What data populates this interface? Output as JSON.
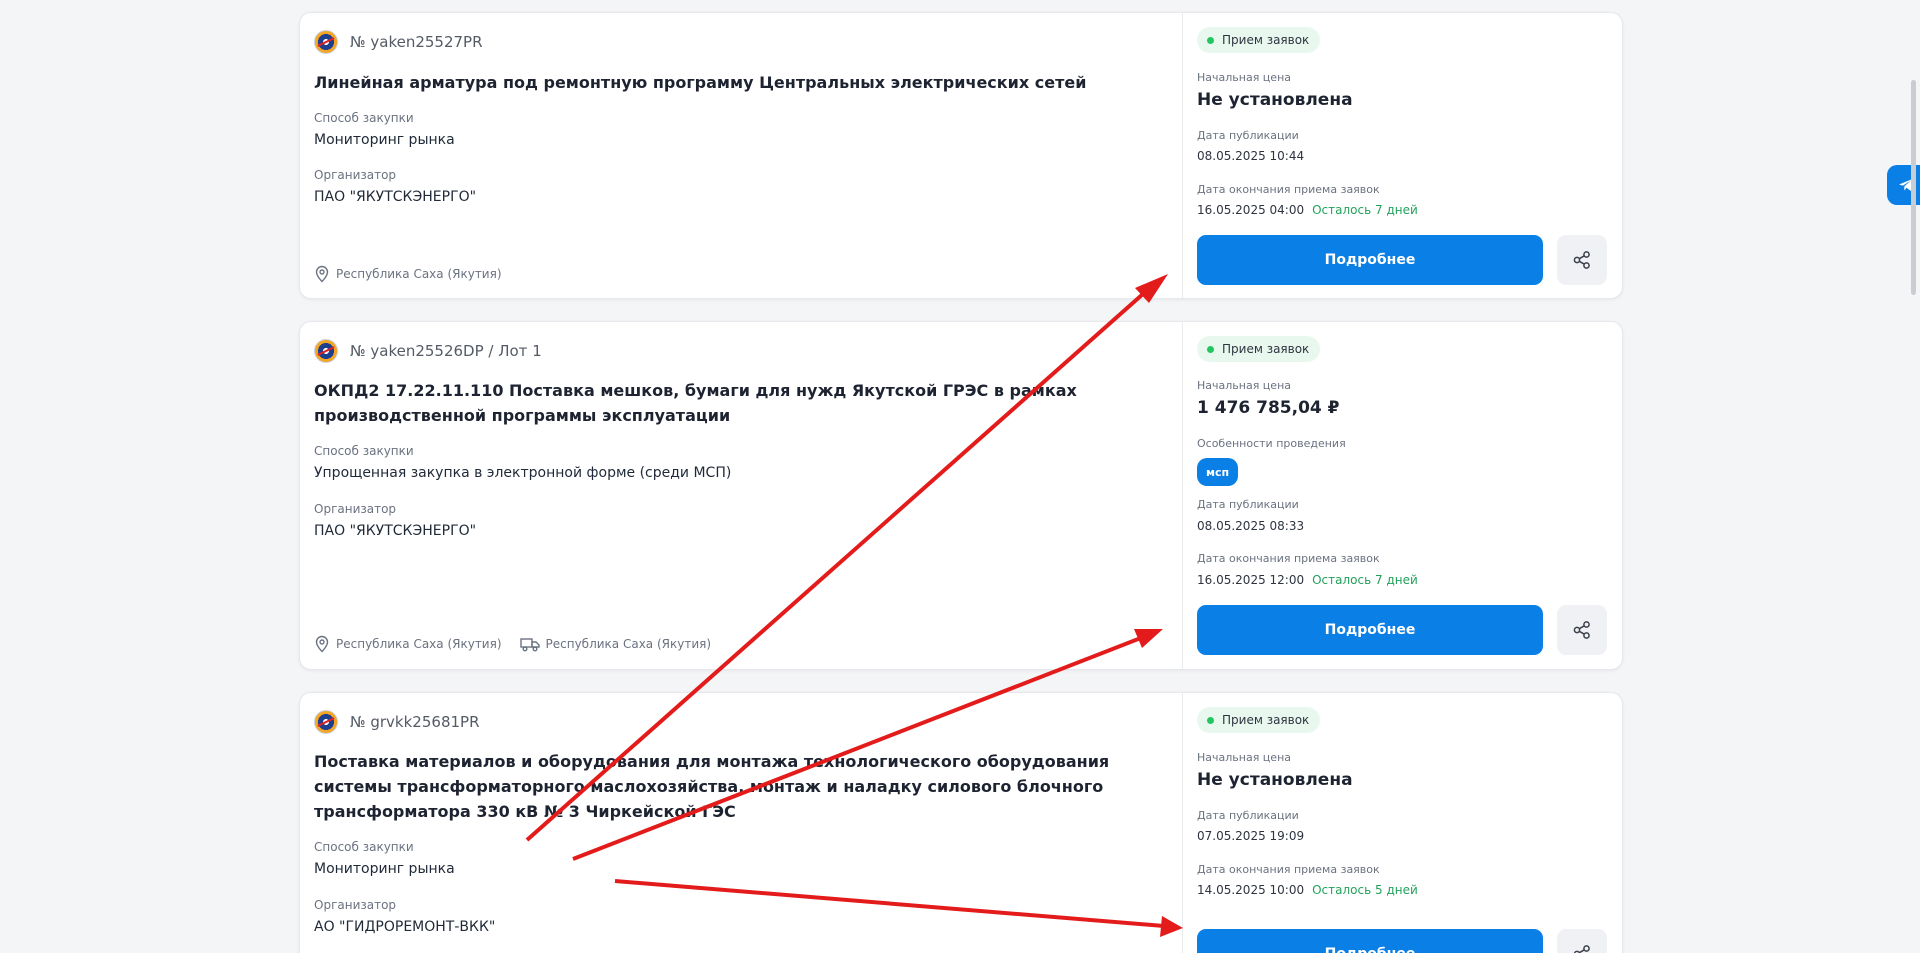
{
  "cards": [
    {
      "number": "№ yaken25527PR",
      "title": "Линейная арматура под ремонтную программу Центральных электрических сетей",
      "method_label": "Способ закупки",
      "method": "Мониторинг рынка",
      "organizer_label": "Организатор",
      "organizer": "ПАО \"ЯКУТСКЭНЕРГО\"",
      "region": "Республика Саха (Якутия)",
      "delivery_region": "",
      "status": "Прием заявок",
      "price_label": "Начальная цена",
      "price": "Не установлена",
      "features_label": "",
      "feature_badge": "",
      "pub_label": "Дата публикации",
      "pub_date": "08.05.2025 10:44",
      "deadline_label": "Дата окончания приема заявок",
      "deadline": "16.05.2025 04:00",
      "remaining": "Осталось 7 дней",
      "more_label": "Подробнее"
    },
    {
      "number": "№ yaken25526DP / Лот 1",
      "title": "ОКПД2 17.22.11.110 Поставка мешков, бумаги для нужд Якутской ГРЭС в рамках производственной программы эксплуатации",
      "method_label": "Способ закупки",
      "method": "Упрощенная закупка в электронной форме (среди МСП)",
      "organizer_label": "Организатор",
      "organizer": "ПАО \"ЯКУТСКЭНЕРГО\"",
      "region": "Республика Саха (Якутия)",
      "delivery_region": "Республика Саха (Якутия)",
      "status": "Прием заявок",
      "price_label": "Начальная цена",
      "price": "1 476 785,04 ₽",
      "features_label": "Особенности проведения",
      "feature_badge": "мсп",
      "pub_label": "Дата публикации",
      "pub_date": "08.05.2025 08:33",
      "deadline_label": "Дата окончания приема заявок",
      "deadline": "16.05.2025 12:00",
      "remaining": "Осталось 7 дней",
      "more_label": "Подробнее"
    },
    {
      "number": "№ grvkk25681PR",
      "title": "Поставка материалов и оборудования для монтажа технологического оборудования системы трансформаторного маслохозяйства, монтаж и наладку силового блочного трансформатора 330 кВ № 3 Чиркейской ГЭС",
      "method_label": "Способ закупки",
      "method": "Мониторинг рынка",
      "organizer_label": "Организатор",
      "organizer": "АО \"ГИДРОРЕМОНТ-ВКК\"",
      "region": "",
      "delivery_region": "",
      "status": "Прием заявок",
      "price_label": "Начальная цена",
      "price": "Не установлена",
      "features_label": "",
      "feature_badge": "",
      "pub_label": "Дата публикации",
      "pub_date": "07.05.2025 19:09",
      "deadline_label": "Дата окончания приема заявок",
      "deadline": "14.05.2025 10:00",
      "remaining": "Осталось 5 дней",
      "more_label": "Подробнее"
    }
  ],
  "icons": {
    "logo": "company-logo-icon",
    "location": "location-pin-icon",
    "delivery": "truck-icon",
    "share": "share-icon",
    "telegram": "telegram-icon"
  },
  "colors": {
    "accent": "#0a7fe6",
    "status_bg": "#e8f8ef",
    "status_dot": "#22c55e",
    "remaining": "#23a15b",
    "annotation_arrows": "#e41b1b"
  }
}
